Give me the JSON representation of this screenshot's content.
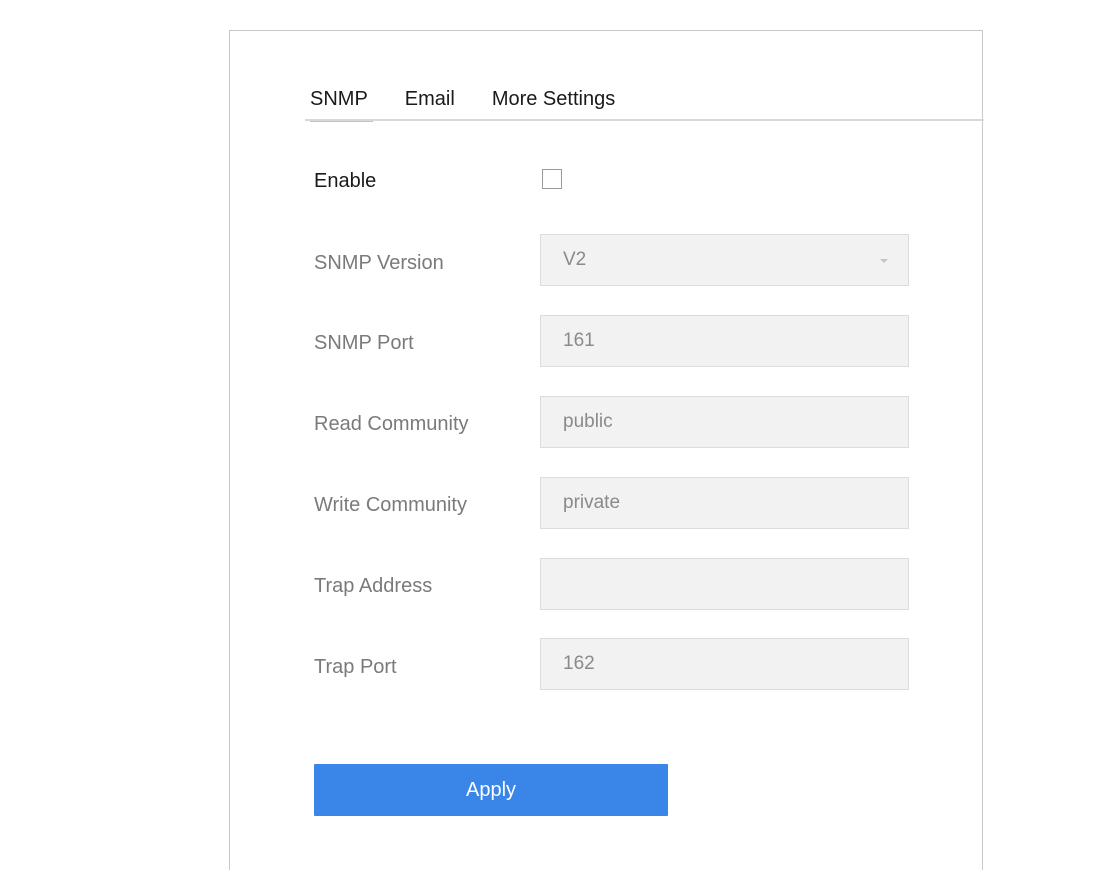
{
  "tabs": [
    {
      "label": "SNMP",
      "active": true
    },
    {
      "label": "Email",
      "active": false
    },
    {
      "label": "More Settings",
      "active": false
    }
  ],
  "form": {
    "enable": {
      "label": "Enable",
      "checked": false
    },
    "snmp_version": {
      "label": "SNMP Version",
      "value": "V2"
    },
    "snmp_port": {
      "label": "SNMP Port",
      "value": "161"
    },
    "read_community": {
      "label": "Read Community",
      "value": "public"
    },
    "write_community": {
      "label": "Write Community",
      "value": "private"
    },
    "trap_address": {
      "label": "Trap Address",
      "value": ""
    },
    "trap_port": {
      "label": "Trap Port",
      "value": "162"
    }
  },
  "apply_label": "Apply",
  "colors": {
    "accent": "#3a86e8",
    "tab_underline": "#f0b48e"
  }
}
